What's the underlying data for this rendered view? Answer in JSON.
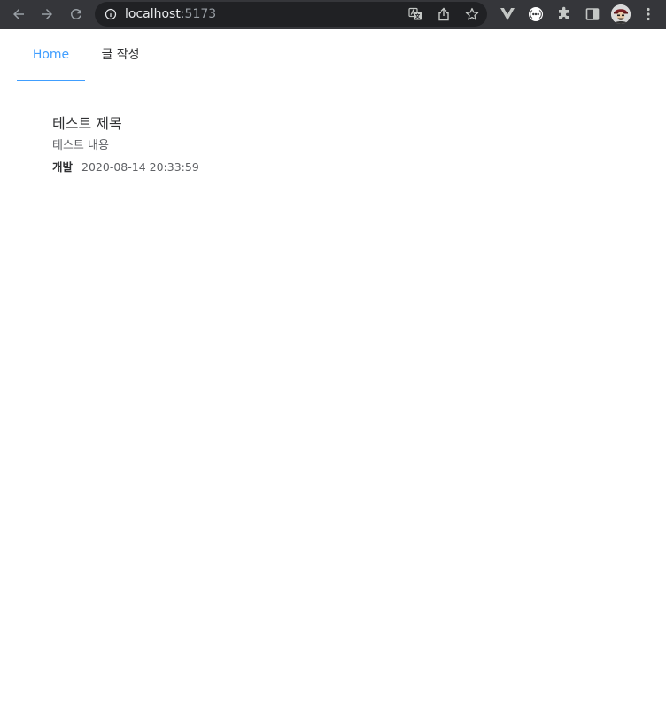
{
  "browser": {
    "url_host": "localhost",
    "url_port": ":5173",
    "icons": {
      "back": "arrow-left-icon",
      "forward": "arrow-right-icon",
      "reload": "reload-icon",
      "site_info": "info-icon",
      "translate": "translate-icon",
      "share": "share-icon",
      "bookmark": "star-icon",
      "ext_vue": "vue-devtools-icon",
      "ext_circle": "extension-circle-icon",
      "extensions": "puzzle-icon",
      "side_panel": "side-panel-icon",
      "profile": "avatar",
      "menu": "kebab-menu-icon"
    }
  },
  "nav": {
    "tabs": [
      {
        "label": "Home",
        "active": true
      },
      {
        "label": "글 작성",
        "active": false
      }
    ]
  },
  "post": {
    "title": "테스트 제목",
    "content": "테스트 내용",
    "category": "개발",
    "date": "2020-08-14 20:33:59"
  },
  "colors": {
    "accent": "#409eff",
    "chrome_bg": "#35363a",
    "omnibox_bg": "#202124",
    "text_primary": "#303133",
    "text_secondary": "#606266",
    "divider": "#e4e7ed"
  }
}
